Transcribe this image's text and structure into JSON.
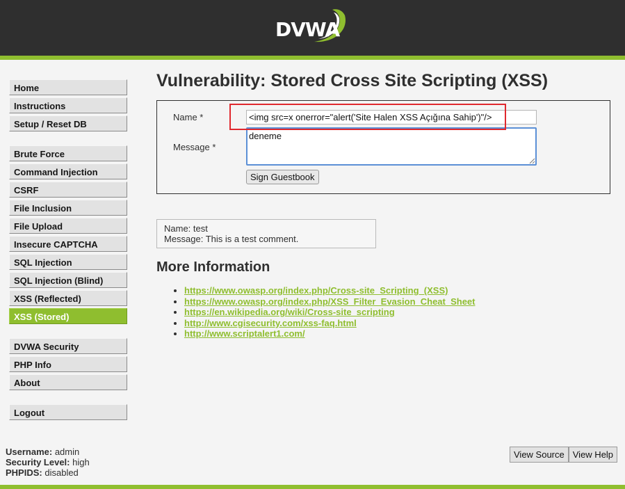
{
  "header": {
    "logo_text": "DVWA",
    "accent_color": "#8fbe2f"
  },
  "menu": {
    "group1": [
      {
        "label": "Home"
      },
      {
        "label": "Instructions"
      },
      {
        "label": "Setup / Reset DB"
      }
    ],
    "group2": [
      {
        "label": "Brute Force"
      },
      {
        "label": "Command Injection"
      },
      {
        "label": "CSRF"
      },
      {
        "label": "File Inclusion"
      },
      {
        "label": "File Upload"
      },
      {
        "label": "Insecure CAPTCHA"
      },
      {
        "label": "SQL Injection"
      },
      {
        "label": "SQL Injection (Blind)"
      },
      {
        "label": "XSS (Reflected)"
      },
      {
        "label": "XSS (Stored)",
        "selected": true
      }
    ],
    "group3": [
      {
        "label": "DVWA Security"
      },
      {
        "label": "PHP Info"
      },
      {
        "label": "About"
      }
    ],
    "group4": [
      {
        "label": "Logout"
      }
    ]
  },
  "main": {
    "title": "Vulnerability: Stored Cross Site Scripting (XSS)",
    "form": {
      "name_label": "Name *",
      "name_value": "<img src=x onerror=\"alert('Site Halen XSS Açığına Sahip')\"/>",
      "message_label": "Message *",
      "message_value": "deneme",
      "submit_label": "Sign Guestbook"
    },
    "entry": {
      "name_line": "Name: test",
      "message_line": "Message: This is a test comment."
    },
    "more_info_title": "More Information",
    "links": [
      "https://www.owasp.org/index.php/Cross-site_Scripting_(XSS)",
      "https://www.owasp.org/index.php/XSS_Filter_Evasion_Cheat_Sheet",
      "https://en.wikipedia.org/wiki/Cross-site_scripting",
      "http://www.cgisecurity.com/xss-faq.html",
      "http://www.scriptalert1.com/"
    ]
  },
  "user_info": {
    "username_label": "Username:",
    "username": "admin",
    "security_label": "Security Level:",
    "security": "high",
    "phpids_label": "PHPIDS:",
    "phpids": "disabled"
  },
  "buttons": {
    "view_source": "View Source",
    "view_help": "View Help"
  },
  "icons": {
    "logo": "dvwa-swoosh-icon",
    "resize": "resize-grip-icon"
  }
}
